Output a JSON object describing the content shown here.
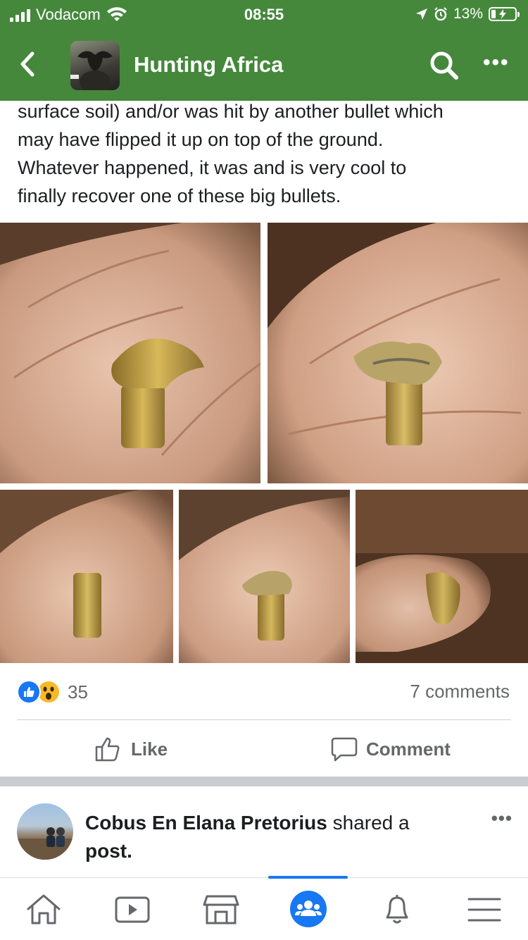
{
  "status_bar": {
    "carrier": "Vodacom",
    "time": "08:55",
    "battery_percent": "13%"
  },
  "nav": {
    "title": "Hunting Africa",
    "more_label": "•••"
  },
  "post": {
    "text_lines": [
      "surface soil) and/or was hit by another bullet which",
      "may have flipped it up on top of the ground.",
      "Whatever happened, it was and is very cool to",
      "finally recover one of these big bullets."
    ],
    "reaction_count": "35",
    "comments_count": "7 comments",
    "like_label": "Like",
    "comment_label": "Comment"
  },
  "next_post": {
    "author": "Cobus En Elana Pretorius",
    "action_text": " shared a",
    "action_text_2": "post.",
    "more_label": "•••"
  },
  "colors": {
    "header_green": "#45883c",
    "facebook_blue": "#1877f2",
    "muted_text": "#65676b"
  },
  "tabbar": {
    "items": [
      "home-icon",
      "watch-icon",
      "marketplace-icon",
      "groups-icon",
      "notifications-icon",
      "menu-icon"
    ],
    "active": "groups-icon"
  }
}
